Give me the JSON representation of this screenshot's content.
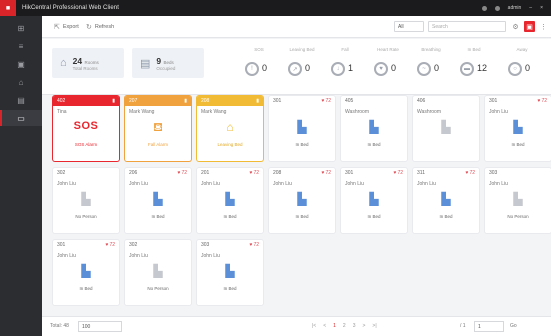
{
  "app": {
    "logo_glyph": "■",
    "title": "HikCentral Professional Web Client",
    "user": "admin"
  },
  "sidebar": {
    "items": [
      {
        "icon": "grid-icon",
        "glyph": "⊞"
      },
      {
        "icon": "list-icon",
        "glyph": "≡"
      },
      {
        "icon": "device-icon",
        "glyph": "▣"
      },
      {
        "icon": "home-icon",
        "glyph": "⌂"
      },
      {
        "icon": "bed-icon",
        "glyph": "▤"
      },
      {
        "icon": "monitor-icon",
        "glyph": "▭"
      }
    ]
  },
  "toolbar": {
    "export_label": "Export",
    "refresh_label": "Refresh",
    "filter_value": "All",
    "search_placeholder": "Search",
    "accent": "#e8262e"
  },
  "summary": [
    {
      "value": "24",
      "unit": "Rooms",
      "label": "Total Rooms",
      "glyph": "⌂"
    },
    {
      "value": "9",
      "unit": "Beds",
      "label": "Occupied",
      "glyph": "▤"
    }
  ],
  "stats": [
    {
      "label": "SOS",
      "value": "0"
    },
    {
      "label": "Leaving Bed",
      "value": "0"
    },
    {
      "label": "Fall",
      "value": "1"
    },
    {
      "label": "Heart Rate",
      "value": "0"
    },
    {
      "label": "Breathing",
      "value": "0"
    },
    {
      "label": "In Bed",
      "value": "12"
    },
    {
      "label": "Away",
      "value": "0"
    }
  ],
  "rooms": [
    {
      "room": "402",
      "name": "Tina",
      "alert": "sos",
      "status": "SOS Alarm",
      "theme": "red"
    },
    {
      "room": "207",
      "name": "Mark Wang",
      "alert": "fall",
      "status": "Fall Alarm",
      "theme": "orange"
    },
    {
      "room": "208",
      "name": "Mark Wang",
      "alert": "leave",
      "status": "Leaving Bed",
      "theme": "yellow"
    },
    {
      "room": "301",
      "name": "",
      "status": "In Bed",
      "heart": "72",
      "icon": "bed"
    },
    {
      "room": "405",
      "name": "Washroom",
      "status": "In Bed",
      "icon": "bed"
    },
    {
      "room": "406",
      "name": "Washroom",
      "status": "",
      "icon": "bed-empty"
    },
    {
      "room": "301",
      "name": "John Liu",
      "status": "In Bed",
      "heart": "72",
      "icon": "bed"
    },
    {
      "room": "302",
      "name": "John Liu",
      "status": "No Person",
      "icon": "bed-empty"
    },
    {
      "room": "206",
      "name": "John Liu",
      "status": "In Bed",
      "heart": "72",
      "icon": "bed"
    },
    {
      "room": "201",
      "name": "John Liu",
      "status": "In Bed",
      "heart": "72",
      "icon": "bed"
    },
    {
      "room": "208",
      "name": "John Liu",
      "status": "In Bed",
      "heart": "72",
      "icon": "bed"
    },
    {
      "room": "301",
      "name": "John Liu",
      "status": "In Bed",
      "heart": "72",
      "icon": "bed"
    },
    {
      "room": "311",
      "name": "John Liu",
      "status": "In Bed",
      "heart": "72",
      "icon": "bed"
    },
    {
      "room": "303",
      "name": "John Liu",
      "status": "No Person",
      "icon": "bed-empty"
    },
    {
      "room": "301",
      "name": "John Liu",
      "status": "In Bed",
      "heart": "72",
      "icon": "bed"
    },
    {
      "room": "302",
      "name": "John Liu",
      "status": "No Person",
      "icon": "bed-empty"
    },
    {
      "room": "303",
      "name": "John Liu",
      "status": "In Bed",
      "heart": "72",
      "icon": "bed"
    }
  ],
  "footer": {
    "per_page_label": "Total: 48",
    "per_page_value": "100",
    "pager": [
      "|<",
      "<",
      "1",
      "2",
      "3",
      ">",
      ">|"
    ],
    "goto_label": "Go",
    "goto_value": "1",
    "page_total": "/ 1"
  }
}
